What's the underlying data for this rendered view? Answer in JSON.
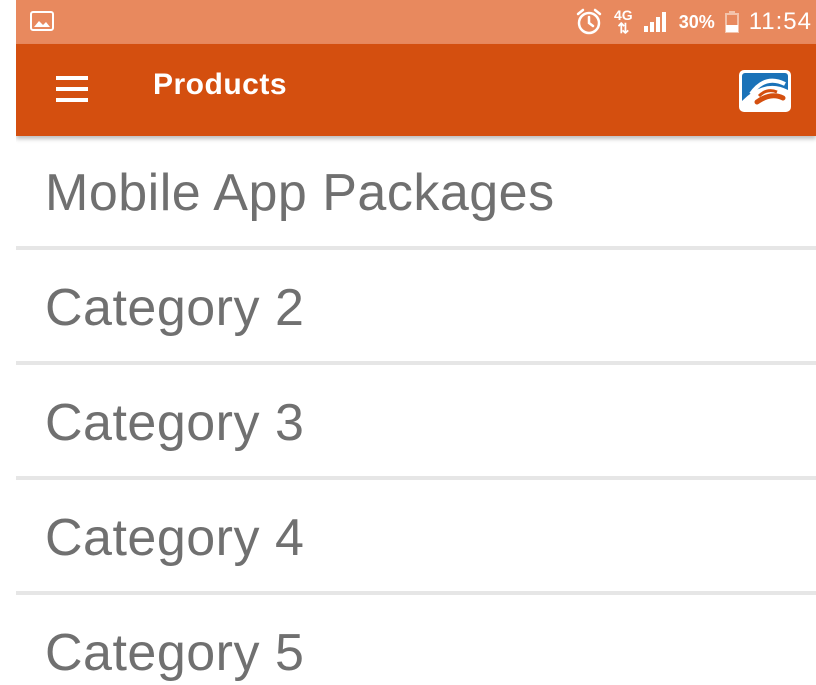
{
  "status_bar": {
    "icons": [
      "gallery-icon",
      "alarm-icon",
      "signal-icon",
      "battery-icon"
    ],
    "network_top": "4G",
    "network_bottom": "⇅",
    "battery_percent": "30%",
    "time": "11:54"
  },
  "app_bar": {
    "menu_icon": "menu-icon",
    "title": "Products",
    "logo": "brand-logo"
  },
  "categories": [
    {
      "label": "Mobile App Packages"
    },
    {
      "label": "Category 2"
    },
    {
      "label": "Category 3"
    },
    {
      "label": "Category 4"
    },
    {
      "label": "Category 5"
    }
  ],
  "colors": {
    "status_bar": "#e8895e",
    "app_bar": "#d44f0f",
    "item_text": "#707070",
    "divider": "#e6e6e6"
  }
}
